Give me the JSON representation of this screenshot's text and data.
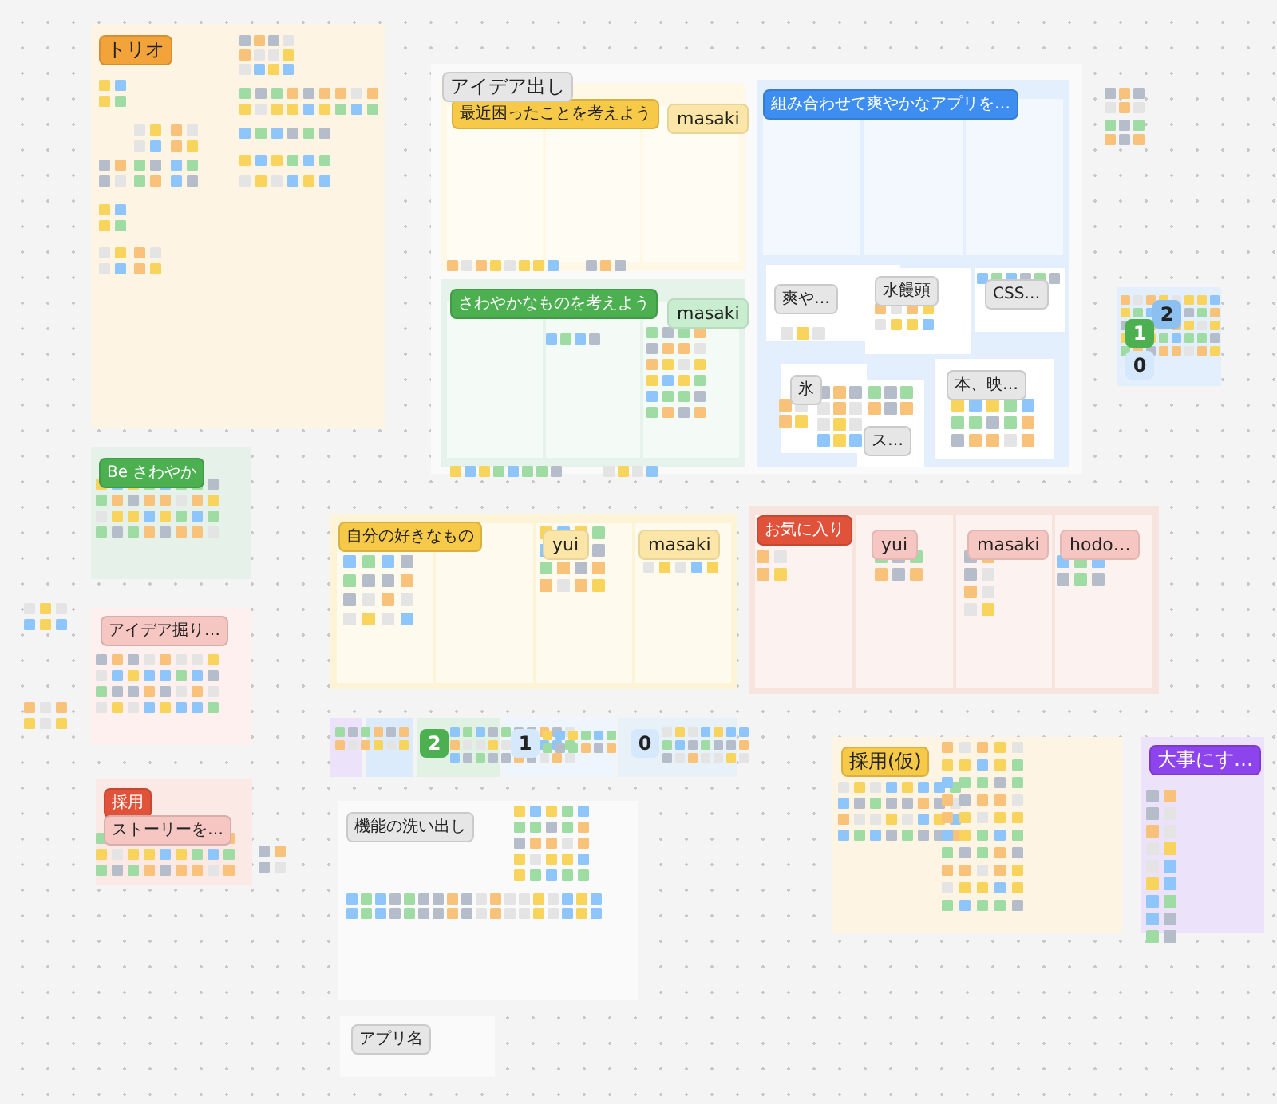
{
  "frames": [
    {
      "title": "トリオ",
      "color": "#f2a33a"
    },
    {
      "title": "アイデア出し",
      "color": "#e6e6e6"
    },
    {
      "title": "最近困ったことを考えよう",
      "color": "#f7c948",
      "columns": [
        {
          "label": "masaki"
        }
      ]
    },
    {
      "title": "さわやかなものを考えよう",
      "color": "#4caf50",
      "columns": [
        {
          "label": "masaki"
        }
      ]
    },
    {
      "title": "組み合わせて爽やかなアプリを…",
      "color": "#3d8ef0"
    },
    {
      "title": "爽や…",
      "color": "#e6e6e6"
    },
    {
      "title": "水饅頭",
      "color": "#e6e6e6"
    },
    {
      "title": "CSS…",
      "color": "#e6e6e6"
    },
    {
      "title": "氷",
      "color": "#e6e6e6"
    },
    {
      "title": "ス…",
      "color": "#e6e6e6"
    },
    {
      "title": "本、映…",
      "color": "#e6e6e6"
    },
    {
      "title": "Be さわやか",
      "color": "#4caf50"
    },
    {
      "title": "アイデア掘り…",
      "color": "#f6c6c2"
    },
    {
      "title": "採用",
      "color": "#e0533a"
    },
    {
      "title": "ストーリーを…",
      "color": "#f6c6c2"
    },
    {
      "title": "自分の好きなもの",
      "color": "#f7c948",
      "columns": [
        {
          "label": "yui"
        },
        {
          "label": "masaki"
        }
      ]
    },
    {
      "title": "お気に入り",
      "color": "#e0533a",
      "columns": [
        {
          "label": "yui"
        },
        {
          "label": "masaki"
        },
        {
          "label": "hodo…"
        }
      ]
    },
    {
      "title": "機能の洗い出し",
      "color": "#e6e6e6"
    },
    {
      "title": "アプリ名",
      "color": "#e6e6e6"
    },
    {
      "title": "採用(仮)",
      "color": "#f7c948"
    },
    {
      "title": "大事にす…",
      "color": "#8e44ec"
    }
  ],
  "vote_badges": [
    {
      "label": "2",
      "color": "#4caf50"
    },
    {
      "label": "1",
      "color": "#d6e8fb"
    },
    {
      "label": "0",
      "color": "#d6e8fb"
    },
    {
      "label": "2",
      "color": "#8cc0f0"
    },
    {
      "label": "1",
      "color": "#4caf50"
    },
    {
      "label": "0",
      "color": "#d6e8fb"
    }
  ]
}
